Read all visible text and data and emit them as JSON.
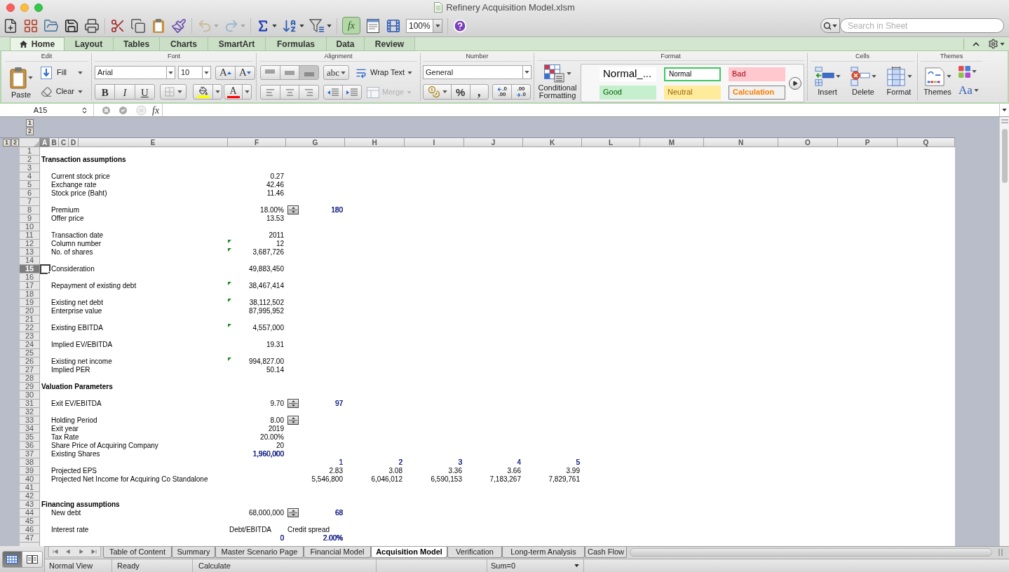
{
  "window": {
    "title": "Refinery Acquisition Model.xlsm"
  },
  "toolbar": {
    "undo": {
      "disabled": true
    },
    "redo": {
      "disabled": true
    },
    "formula_builder": {
      "label": "fx",
      "selected": true
    },
    "zoom": "100%",
    "search": {
      "placeholder": "Search in Sheet"
    }
  },
  "ribbon": {
    "tabs": [
      {
        "label": "Home",
        "kind": "home",
        "selected": true
      },
      {
        "label": "Layout",
        "kind": "plain",
        "selected": false
      },
      {
        "label": "Tables",
        "kind": "plain",
        "selected": false
      },
      {
        "label": "Charts",
        "kind": "plain",
        "selected": false
      },
      {
        "label": "SmartArt",
        "kind": "plain",
        "selected": false
      },
      {
        "label": "Formulas",
        "kind": "plain",
        "selected": false
      },
      {
        "label": "Data",
        "kind": "plain",
        "selected": false
      },
      {
        "label": "Review",
        "kind": "plain",
        "selected": false
      }
    ],
    "edit": {
      "title": "Edit",
      "paste": "Paste",
      "fill": "Fill",
      "clear": "Clear"
    },
    "font": {
      "title": "Font",
      "family": "Arial",
      "size": "10",
      "grow": "A",
      "shrink": "A",
      "bold": "B",
      "italic": "I",
      "underline": "U",
      "font_color": "A"
    },
    "alignment": {
      "title": "Alignment",
      "vertical": [
        {
          "kind": "top",
          "selected": false
        },
        {
          "kind": "middle",
          "selected": false
        },
        {
          "kind": "bottom",
          "selected": true
        }
      ],
      "horizontal": [
        {
          "kind": "left",
          "selected": false
        },
        {
          "kind": "center",
          "selected": false
        },
        {
          "kind": "right",
          "selected": false
        }
      ],
      "orientation": "abc",
      "wrap_text": "Wrap Text",
      "merge": {
        "label": "Merge",
        "disabled": true
      }
    },
    "number": {
      "title": "Number",
      "format": "General",
      "percent": "%",
      "comma": ",",
      "increase_decimal": [
        ".0",
        ".00"
      ],
      "decrease_decimal": [
        ".00",
        ".0"
      ]
    },
    "format": {
      "title": "Format",
      "conditional_formatting": "Conditional Formatting",
      "styles": [
        {
          "label": "Normal_...",
          "kind": "normal_large",
          "selected": false
        },
        {
          "label": "Normal",
          "kind": "normal",
          "selected": true
        },
        {
          "label": "Bad",
          "kind": "bad",
          "selected": false
        },
        {
          "label": "Good",
          "kind": "good",
          "selected": false
        },
        {
          "label": "Neutral",
          "kind": "neutral",
          "selected": false
        },
        {
          "label": "Calculation",
          "kind": "calculation",
          "selected": false
        }
      ]
    },
    "cells": {
      "title": "Cells",
      "insert": "Insert",
      "delete": "Delete",
      "format": "Format"
    },
    "themes": {
      "title": "Themes",
      "themes": "Themes",
      "fonts": "Aa"
    }
  },
  "formula_bar": {
    "name_box": "A15",
    "fx": "fx"
  },
  "outline": {
    "column_levels": [
      "1",
      "2"
    ],
    "row_levels": [
      "1",
      "2"
    ]
  },
  "columns": [
    {
      "letter": "A",
      "selected": true
    },
    {
      "letter": "B",
      "selected": false
    },
    {
      "letter": "C",
      "selected": false
    },
    {
      "letter": "D",
      "selected": false
    },
    {
      "letter": "E",
      "selected": false
    },
    {
      "letter": "F",
      "selected": false
    },
    {
      "letter": "G",
      "selected": false
    },
    {
      "letter": "H",
      "selected": false
    },
    {
      "letter": "I",
      "selected": false
    },
    {
      "letter": "J",
      "selected": false
    },
    {
      "letter": "K",
      "selected": false
    },
    {
      "letter": "L",
      "selected": false
    },
    {
      "letter": "M",
      "selected": false
    },
    {
      "letter": "N",
      "selected": false
    },
    {
      "letter": "O",
      "selected": false
    },
    {
      "letter": "P",
      "selected": false
    },
    {
      "letter": "Q",
      "selected": false
    }
  ],
  "rows": [
    {
      "number": "1",
      "selected": false,
      "spinner": false,
      "flagged": false
    },
    {
      "number": "2",
      "selected": false,
      "spinner": false,
      "flagged": false,
      "cells": [
        {
          "kind": "heading",
          "text": "Transaction assumptions"
        }
      ]
    },
    {
      "number": "3",
      "selected": false,
      "spinner": false,
      "flagged": false
    },
    {
      "number": "4",
      "selected": false,
      "spinner": false,
      "flagged": false,
      "cells": [
        null,
        {
          "kind": "label",
          "text": "Current stock price"
        },
        null,
        null,
        null,
        {
          "kind": "number",
          "text": "0.27"
        }
      ]
    },
    {
      "number": "5",
      "selected": false,
      "spinner": false,
      "flagged": false,
      "cells": [
        null,
        {
          "kind": "label",
          "text": "Exchange rate"
        },
        null,
        null,
        null,
        {
          "kind": "number",
          "text": "42.46"
        }
      ]
    },
    {
      "number": "6",
      "selected": false,
      "spinner": false,
      "flagged": false,
      "cells": [
        null,
        {
          "kind": "label",
          "text": "Stock price (Baht)"
        },
        null,
        null,
        null,
        {
          "kind": "number",
          "text": "11.46"
        }
      ]
    },
    {
      "number": "7",
      "selected": false,
      "spinner": false,
      "flagged": false
    },
    {
      "number": "8",
      "selected": false,
      "spinner": true,
      "flagged": false,
      "cells": [
        null,
        {
          "kind": "label",
          "text": "Premium"
        },
        null,
        null,
        null,
        {
          "kind": "number",
          "text": "18.00%"
        },
        {
          "kind": "number",
          "text": "180",
          "color": "#1d2a8a"
        }
      ]
    },
    {
      "number": "9",
      "selected": false,
      "spinner": false,
      "flagged": false,
      "cells": [
        null,
        {
          "kind": "label",
          "text": "Offer price"
        },
        null,
        null,
        null,
        {
          "kind": "number",
          "text": "13.53"
        }
      ]
    },
    {
      "number": "10",
      "selected": false,
      "spinner": false,
      "flagged": false
    },
    {
      "number": "11",
      "selected": false,
      "spinner": false,
      "flagged": false,
      "cells": [
        null,
        {
          "kind": "label",
          "text": "Transaction date"
        },
        null,
        null,
        null,
        {
          "kind": "number",
          "text": "2011"
        }
      ]
    },
    {
      "number": "12",
      "selected": false,
      "spinner": false,
      "flagged": true,
      "cells": [
        null,
        {
          "kind": "label",
          "text": "Column number"
        },
        null,
        null,
        null,
        {
          "kind": "number",
          "text": "12"
        }
      ]
    },
    {
      "number": "13",
      "selected": false,
      "spinner": false,
      "flagged": true,
      "cells": [
        null,
        {
          "kind": "label",
          "text": "No. of shares"
        },
        null,
        null,
        null,
        {
          "kind": "number",
          "text": "3,687,726"
        }
      ]
    },
    {
      "number": "14",
      "selected": false,
      "spinner": false,
      "flagged": false
    },
    {
      "number": "15",
      "selected": true,
      "spinner": false,
      "flagged": false,
      "cells": [
        null,
        {
          "kind": "label",
          "text": "Consideration"
        },
        null,
        null,
        null,
        {
          "kind": "number",
          "text": "49,883,450"
        }
      ]
    },
    {
      "number": "16",
      "selected": false,
      "spinner": false,
      "flagged": false
    },
    {
      "number": "17",
      "selected": false,
      "spinner": false,
      "flagged": true,
      "cells": [
        null,
        {
          "kind": "label",
          "text": "Repayment of existing debt"
        },
        null,
        null,
        null,
        {
          "kind": "number",
          "text": "38,467,414"
        }
      ]
    },
    {
      "number": "18",
      "selected": false,
      "spinner": false,
      "flagged": false
    },
    {
      "number": "19",
      "selected": false,
      "spinner": false,
      "flagged": true,
      "cells": [
        null,
        {
          "kind": "label",
          "text": "Existing net debt"
        },
        null,
        null,
        null,
        {
          "kind": "number",
          "text": "38,112,502"
        }
      ]
    },
    {
      "number": "20",
      "selected": false,
      "spinner": false,
      "flagged": false,
      "cells": [
        null,
        {
          "kind": "label",
          "text": "Enterprise value"
        },
        null,
        null,
        null,
        {
          "kind": "number",
          "text": "87,995,952"
        }
      ]
    },
    {
      "number": "21",
      "selected": false,
      "spinner": false,
      "flagged": false
    },
    {
      "number": "22",
      "selected": false,
      "spinner": false,
      "flagged": true,
      "cells": [
        null,
        {
          "kind": "label",
          "text": "Existing EBITDA"
        },
        null,
        null,
        null,
        {
          "kind": "number",
          "text": "4,557,000"
        }
      ]
    },
    {
      "number": "23",
      "selected": false,
      "spinner": false,
      "flagged": false
    },
    {
      "number": "24",
      "selected": false,
      "spinner": false,
      "flagged": false,
      "cells": [
        null,
        {
          "kind": "label",
          "text": "Implied EV/EBITDA"
        },
        null,
        null,
        null,
        {
          "kind": "number",
          "text": "19.31"
        }
      ]
    },
    {
      "number": "25",
      "selected": false,
      "spinner": false,
      "flagged": false
    },
    {
      "number": "26",
      "selected": false,
      "spinner": false,
      "flagged": true,
      "cells": [
        null,
        {
          "kind": "label",
          "text": "Existing net income"
        },
        null,
        null,
        null,
        {
          "kind": "number",
          "text": "994,827.00"
        }
      ]
    },
    {
      "number": "27",
      "selected": false,
      "spinner": false,
      "flagged": false,
      "cells": [
        null,
        {
          "kind": "label",
          "text": "Implied PER"
        },
        null,
        null,
        null,
        {
          "kind": "number",
          "text": "50.14"
        }
      ]
    },
    {
      "number": "28",
      "selected": false,
      "spinner": false,
      "flagged": false
    },
    {
      "number": "29",
      "selected": false,
      "spinner": false,
      "flagged": false,
      "cells": [
        {
          "kind": "heading",
          "text": "Valuation Parameters"
        }
      ]
    },
    {
      "number": "30",
      "selected": false,
      "spinner": false,
      "flagged": false
    },
    {
      "number": "31",
      "selected": false,
      "spinner": true,
      "flagged": false,
      "cells": [
        null,
        {
          "kind": "label",
          "text": "Exit EV/EBITDA"
        },
        null,
        null,
        null,
        {
          "kind": "number",
          "text": "9.70"
        },
        {
          "kind": "number",
          "text": "97",
          "color": "#1d2a8a"
        }
      ]
    },
    {
      "number": "32",
      "selected": false,
      "spinner": false,
      "flagged": false
    },
    {
      "number": "33",
      "selected": false,
      "spinner": true,
      "flagged": false,
      "cells": [
        null,
        {
          "kind": "label",
          "text": "Holding Period"
        },
        null,
        null,
        null,
        {
          "kind": "number",
          "text": "8.00"
        }
      ]
    },
    {
      "number": "34",
      "selected": false,
      "spinner": false,
      "flagged": false,
      "cells": [
        null,
        {
          "kind": "label",
          "text": "Exit year"
        },
        null,
        null,
        null,
        {
          "kind": "number",
          "text": "2019"
        }
      ]
    },
    {
      "number": "35",
      "selected": false,
      "spinner": false,
      "flagged": false,
      "cells": [
        null,
        {
          "kind": "label",
          "text": "Tax Rate"
        },
        null,
        null,
        null,
        {
          "kind": "number",
          "text": "20.00%"
        }
      ]
    },
    {
      "number": "36",
      "selected": false,
      "spinner": false,
      "flagged": false,
      "cells": [
        null,
        {
          "kind": "label",
          "text": "Share Price of Acquiring Company"
        },
        null,
        null,
        null,
        {
          "kind": "number",
          "text": "20"
        }
      ]
    },
    {
      "number": "37",
      "selected": false,
      "spinner": false,
      "flagged": false,
      "cells": [
        null,
        {
          "kind": "label",
          "text": "Existing Shares"
        },
        null,
        null,
        null,
        {
          "kind": "number",
          "text": "1,960,000",
          "color": "#1d2a8a"
        }
      ]
    },
    {
      "number": "38",
      "selected": false,
      "spinner": false,
      "flagged": false,
      "cells": [
        null,
        null,
        null,
        null,
        null,
        null,
        {
          "kind": "number",
          "text": "1",
          "color": "#1d2a8a"
        },
        {
          "kind": "number",
          "text": "2",
          "color": "#1d2a8a"
        },
        {
          "kind": "number",
          "text": "3",
          "color": "#1d2a8a"
        },
        {
          "kind": "number",
          "text": "4",
          "color": "#1d2a8a"
        },
        {
          "kind": "number",
          "text": "5",
          "color": "#1d2a8a"
        }
      ]
    },
    {
      "number": "39",
      "selected": false,
      "spinner": false,
      "flagged": false,
      "cells": [
        null,
        {
          "kind": "label",
          "text": "Projected EPS"
        },
        null,
        null,
        null,
        null,
        {
          "kind": "number",
          "text": "2.83"
        },
        {
          "kind": "number",
          "text": "3.08"
        },
        {
          "kind": "number",
          "text": "3.36"
        },
        {
          "kind": "number",
          "text": "3.66"
        },
        {
          "kind": "number",
          "text": "3.99"
        }
      ]
    },
    {
      "number": "40",
      "selected": false,
      "spinner": false,
      "flagged": false,
      "cells": [
        null,
        {
          "kind": "label",
          "text": "Projected Net Income for Acquiring Co Standalone"
        },
        null,
        null,
        null,
        null,
        {
          "kind": "number",
          "text": "5,546,800"
        },
        {
          "kind": "number",
          "text": "6,046,012"
        },
        {
          "kind": "number",
          "text": "6,590,153"
        },
        {
          "kind": "number",
          "text": "7,183,267"
        },
        {
          "kind": "number",
          "text": "7,829,761"
        }
      ]
    },
    {
      "number": "41",
      "selected": false,
      "spinner": false,
      "flagged": false
    },
    {
      "number": "42",
      "selected": false,
      "spinner": false,
      "flagged": false
    },
    {
      "number": "43",
      "selected": false,
      "spinner": false,
      "flagged": false,
      "cells": [
        {
          "kind": "heading",
          "text": "Financing assumptions"
        }
      ]
    },
    {
      "number": "44",
      "selected": false,
      "spinner": true,
      "flagged": false,
      "cells": [
        null,
        {
          "kind": "label",
          "text": "New debt"
        },
        null,
        null,
        null,
        {
          "kind": "number",
          "text": "68,000,000"
        },
        {
          "kind": "number",
          "text": "68",
          "color": "#1d2a8a"
        }
      ]
    },
    {
      "number": "45",
      "selected": false,
      "spinner": false,
      "flagged": false
    },
    {
      "number": "46",
      "selected": false,
      "spinner": false,
      "flagged": false,
      "cells": [
        null,
        {
          "kind": "label",
          "text": "Interest rate"
        },
        null,
        null,
        null,
        {
          "kind": "label",
          "text": "Debt/EBITDA"
        },
        {
          "kind": "label",
          "text": "Credit spread"
        }
      ]
    },
    {
      "number": "47",
      "selected": false,
      "spinner": false,
      "flagged": false,
      "cells": [
        null,
        null,
        null,
        null,
        null,
        {
          "kind": "number",
          "text": "0",
          "color": "#1d2a8a"
        },
        {
          "kind": "number",
          "text": "2.00%",
          "color": "#1d2a8a"
        }
      ]
    }
  ],
  "sheet_tabs": [
    {
      "label": "Table of Content",
      "selected": false
    },
    {
      "label": "Summary",
      "selected": false
    },
    {
      "label": "Master Scenario Page",
      "selected": false
    },
    {
      "label": "Financial Model",
      "selected": false
    },
    {
      "label": "Acquisition Model",
      "selected": true
    },
    {
      "label": "Verification",
      "selected": false
    },
    {
      "label": "Long-term Analysis",
      "selected": false
    },
    {
      "label": "Cash Flow",
      "selected": false
    }
  ],
  "status_bar": {
    "views": [
      {
        "kind": "normal",
        "selected": true
      },
      {
        "kind": "page_layout",
        "selected": false
      }
    ],
    "view": "Normal View",
    "mode": "Ready",
    "calculation": "Calculate",
    "sum": "Sum=0"
  }
}
